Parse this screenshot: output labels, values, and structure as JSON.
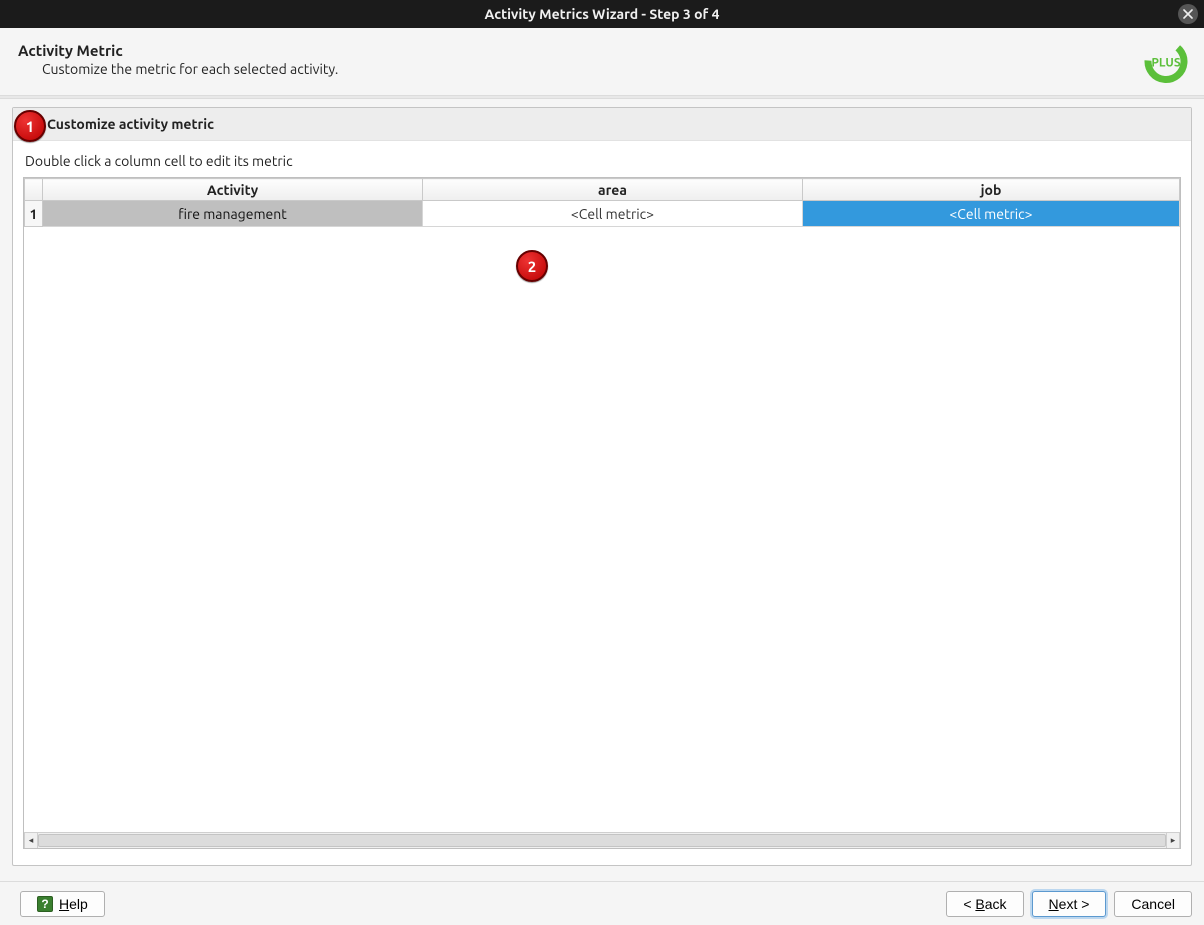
{
  "window": {
    "title": "Activity Metrics Wizard - Step 3 of 4"
  },
  "header": {
    "title": "Activity Metric",
    "subtitle": "Customize the metric for each selected activity."
  },
  "logo": {
    "text": "PLUS"
  },
  "group": {
    "checkbox_label": "Customize activity metric",
    "checked": true,
    "hint": "Double click a column cell to edit its metric"
  },
  "table": {
    "columns": [
      "Activity",
      "area",
      "job"
    ],
    "rows": [
      {
        "n": "1",
        "activity": "fire management",
        "area": "<Cell metric>",
        "job": "<Cell metric>",
        "selected_col": "job"
      }
    ]
  },
  "footer": {
    "help": "Help",
    "back": "< Back",
    "next": "Next >",
    "cancel": "Cancel"
  },
  "annotations": {
    "badge1": "1",
    "badge2": "2"
  }
}
